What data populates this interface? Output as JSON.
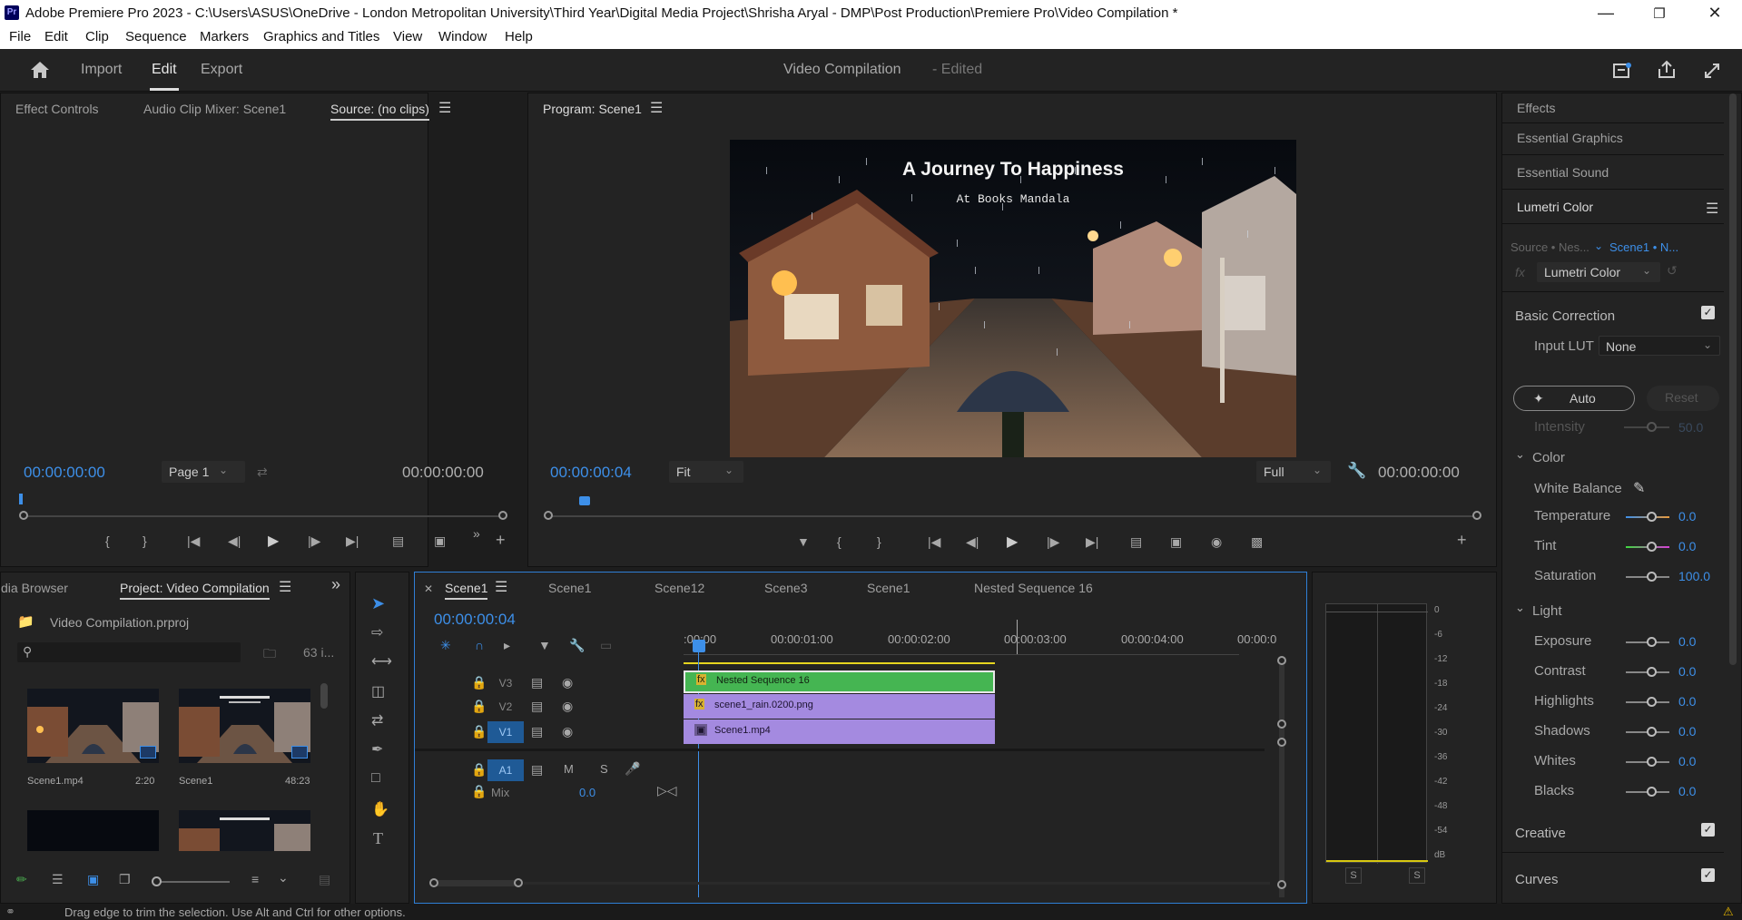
{
  "window": {
    "title": "Adobe Premiere Pro 2023 - C:\\Users\\ASUS\\OneDrive - London Metropolitan University\\Third Year\\Digital Media Project\\Shrisha Aryal - DMP\\Post Production\\Premiere Pro\\Video Compilation *",
    "logo": "Pr"
  },
  "menu": [
    "File",
    "Edit",
    "Clip",
    "Sequence",
    "Markers",
    "Graphics and Titles",
    "View",
    "Window",
    "Help"
  ],
  "header": {
    "tabs": [
      "Import",
      "Edit",
      "Export"
    ],
    "active": "Edit",
    "project": "Video Compilation",
    "edited": "- Edited"
  },
  "source": {
    "tabs": [
      "Effect Controls",
      "Audio Clip Mixer: Scene1",
      "Source: (no clips)"
    ],
    "tc_left": "00:00:00:00",
    "page": "Page 1",
    "tc_right": "00:00:00:00"
  },
  "program": {
    "title": "Program: Scene1",
    "tc_left": "00:00:00:04",
    "fit": "Fit",
    "quality": "Full",
    "tc_right": "00:00:00:00",
    "video_title": "A Journey To Happiness",
    "video_subtitle": "At Books Mandala"
  },
  "project": {
    "tabs": [
      "dia Browser",
      "Project: Video Compilation"
    ],
    "file": "Video Compilation.prproj",
    "count": "63 i...",
    "items": [
      {
        "name": "Scene1.mp4",
        "duration": "2:20"
      },
      {
        "name": "Scene1",
        "duration": "48:23"
      }
    ]
  },
  "timeline": {
    "tabs": [
      "Scene1",
      "Scene1",
      "Scene12",
      "Scene3",
      "Scene1",
      "Nested Sequence 16"
    ],
    "tc": "00:00:00:04",
    "ruler": [
      ":00:00",
      "00:00:01:00",
      "00:00:02:00",
      "00:00:03:00",
      "00:00:04:00",
      "00:00:0"
    ],
    "tracks": [
      "V3",
      "V2",
      "V1",
      "A1"
    ],
    "mix_label": "Mix",
    "mix_value": "0.0",
    "clips": [
      {
        "name": "Nested Sequence 16",
        "color": "#45b552"
      },
      {
        "name": "scene1_rain.0200.png",
        "color": "#a48ae0"
      },
      {
        "name": "Scene1.mp4",
        "color": "#a48ae0"
      }
    ],
    "audio_M": "M",
    "audio_S": "S"
  },
  "meter": {
    "scale": [
      "0",
      "-6",
      "-12",
      "-18",
      "-24",
      "-30",
      "-36",
      "-42",
      "-48",
      "-54",
      "dB"
    ],
    "solo": [
      "S",
      "S"
    ]
  },
  "right": {
    "panels": [
      "Effects",
      "Essential Graphics",
      "Essential Sound",
      "Lumetri Color"
    ],
    "source_label": "Source • Nes...",
    "seq_label": "Scene1 • N...",
    "fx": "fx",
    "effect": "Lumetri Color",
    "basic": "Basic Correction",
    "input_lut_label": "Input LUT",
    "input_lut": "None",
    "auto": "Auto",
    "reset": "Reset",
    "intensity_label": "Intensity",
    "intensity": "50.0",
    "color_section": "Color",
    "white_balance": "White Balance",
    "color_params": [
      {
        "name": "Temperature",
        "value": "0.0"
      },
      {
        "name": "Tint",
        "value": "0.0"
      },
      {
        "name": "Saturation",
        "value": "100.0"
      }
    ],
    "light_section": "Light",
    "light_params": [
      {
        "name": "Exposure",
        "value": "0.0"
      },
      {
        "name": "Contrast",
        "value": "0.0"
      },
      {
        "name": "Highlights",
        "value": "0.0"
      },
      {
        "name": "Shadows",
        "value": "0.0"
      },
      {
        "name": "Whites",
        "value": "0.0"
      },
      {
        "name": "Blacks",
        "value": "0.0"
      }
    ],
    "creative": "Creative",
    "curves": "Curves"
  },
  "status": "Drag edge to trim the selection. Use Alt and Ctrl for other options."
}
